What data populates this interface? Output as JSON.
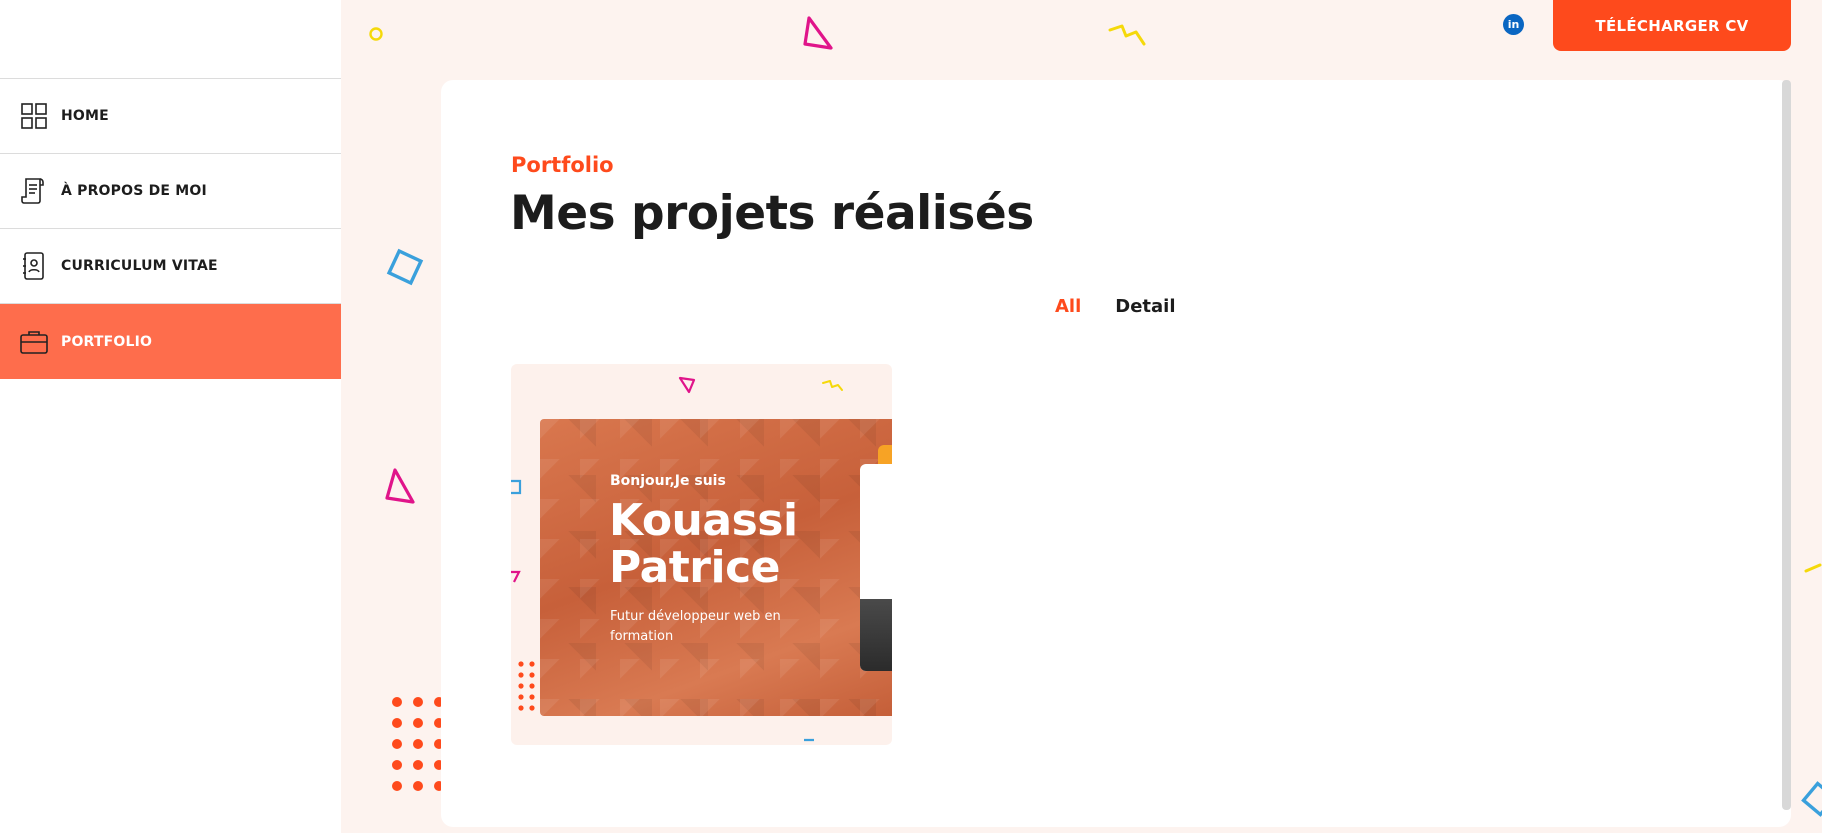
{
  "sidebar": {
    "items": [
      {
        "label": "HOME",
        "icon": "grid-icon",
        "active": false
      },
      {
        "label": "À PROPOS DE MOI",
        "icon": "document-icon",
        "active": false
      },
      {
        "label": "CURRICULUM VITAE",
        "icon": "contact-book-icon",
        "active": false
      },
      {
        "label": "PORTFOLIO",
        "icon": "briefcase-icon",
        "active": true
      }
    ]
  },
  "header": {
    "linkedin_icon": "linkedin-icon",
    "linkedin_text": "in",
    "cv_button": "TÉLÉCHARGER CV"
  },
  "main": {
    "eyebrow": "Portfolio",
    "title": "Mes projets réalisés",
    "filters": [
      {
        "label": "All",
        "active": true
      },
      {
        "label": "Detail",
        "active": false
      }
    ],
    "projects": [
      {
        "greeting": "Bonjour,Je suis",
        "name_line1": "Kouassi",
        "name_line2": "Patrice",
        "tagline": "Futur développeur web en formation"
      }
    ]
  },
  "colors": {
    "accent": "#fe4a1c",
    "active_nav": "#fe6d4c",
    "background": "#fdf3ef",
    "deco_pink": "#e0148a",
    "deco_blue": "#3aa0dc",
    "deco_yellow": "#f5d90a"
  }
}
